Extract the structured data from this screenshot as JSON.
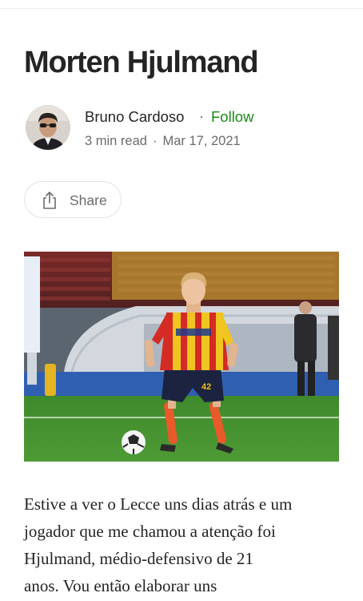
{
  "article": {
    "title": "Morten Hjulmand",
    "author": {
      "name": "Bruno Cardoso",
      "separator": "·",
      "follow_label": "Follow",
      "read_time": "3 min read",
      "meta_separator": "·",
      "date": "Mar 17, 2021"
    },
    "share": {
      "label": "Share",
      "icon": "share-icon"
    },
    "hero_image": {
      "description_icon": "photo",
      "jersey_number": "42"
    },
    "body_lines": [
      "Estive a ver o Lecce uns dias atrás e um",
      "jogador que me chamou a atenção foi",
      "Hjulmand, médio-defensivo de 21",
      "anos. Vou então elaborar uns"
    ]
  },
  "colors": {
    "text": "#242424",
    "muted": "#6b6b6b",
    "follow": "#1a8917",
    "divider": "#ececec"
  }
}
